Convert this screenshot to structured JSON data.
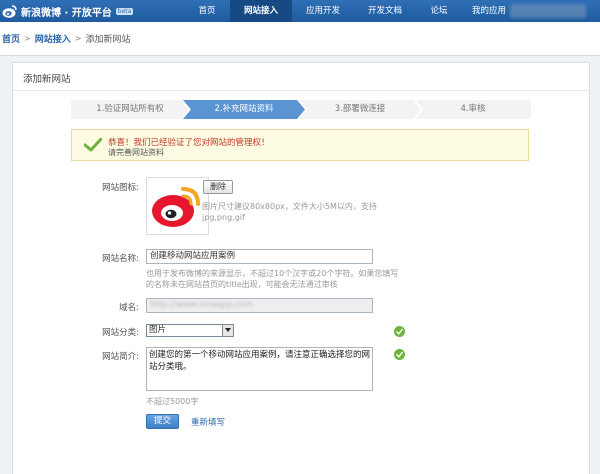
{
  "brand": {
    "name": "新浪微博 · 开放平台",
    "badge": "beta",
    "colors": {
      "header": "#2f6fb6",
      "active_nav": "#174a85",
      "link": "#2e67a8"
    }
  },
  "nav": {
    "items": [
      {
        "label": "首页",
        "active": false
      },
      {
        "label": "网站接入",
        "active": true
      },
      {
        "label": "应用开发",
        "active": false
      },
      {
        "label": "开发文档",
        "active": false
      },
      {
        "label": "论坛",
        "active": false
      },
      {
        "label": "我的应用",
        "active": false
      }
    ]
  },
  "breadcrumb": {
    "home": "首页",
    "section": "网站接入",
    "current": "添加新网站"
  },
  "card": {
    "title": "添加新网站"
  },
  "steps": [
    {
      "label": "1.验证网站所有权",
      "active": false
    },
    {
      "label": "2.补充网站资料",
      "active": true
    },
    {
      "label": "3.部署微连接",
      "active": false
    },
    {
      "label": "4.审核",
      "active": false
    }
  ],
  "success": {
    "title": "恭喜！我们已经验证了您对网站的管理权！",
    "subtitle": "请完善网站资料"
  },
  "form": {
    "icon": {
      "label": "网站图标:",
      "delete_button": "删除",
      "hint": "图片尺寸建议80x80px，文件大小5M以内，支持jpg,png,gif"
    },
    "name": {
      "label": "网站名称:",
      "value": "创建移动网站应用案例",
      "hint": "也用于发布微博的来源显示，不超过10个汉字或20个字符。如果您填写的名称未在网站首页的title出现，可能会无法通过审核"
    },
    "domain": {
      "label": "域名:",
      "value": "http://www.sinaapp.com"
    },
    "category": {
      "label": "网站分类:",
      "selected": "图片"
    },
    "intro": {
      "label": "网站简介:",
      "value": "创建您的第一个移动网站应用案例，请注意正确选择您的网站分类哦。",
      "hint": "不超过5000字"
    },
    "submit": "提交",
    "reset": "重新填写"
  }
}
